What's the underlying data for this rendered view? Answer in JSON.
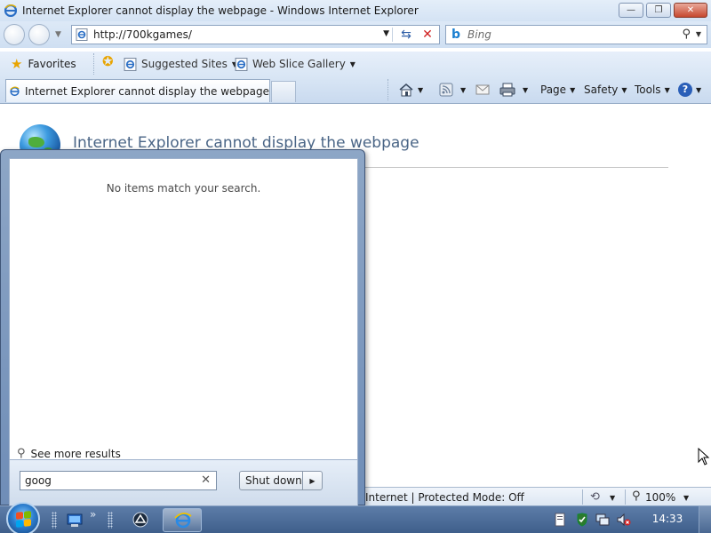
{
  "window": {
    "title": "Internet Explorer cannot display the webpage - Windows Internet Explorer",
    "controls": [
      "minimize",
      "maximize",
      "close"
    ]
  },
  "address_bar": {
    "url": "http://700kgames/"
  },
  "search_box": {
    "placeholder": "Bing"
  },
  "favorites_bar": {
    "favorites_label": "Favorites",
    "links": [
      {
        "label": "Suggested Sites"
      },
      {
        "label": "Web Slice Gallery"
      }
    ]
  },
  "tab": {
    "label": "Internet Explorer cannot display the webpage"
  },
  "command_bar": {
    "page_label": "Page",
    "safety_label": "Safety",
    "tools_label": "Tools"
  },
  "page": {
    "error_title": "Internet Explorer cannot display the webpage"
  },
  "status_bar": {
    "zone_text": "Internet | Protected Mode: Off",
    "zoom": "100%"
  },
  "start_menu": {
    "empty_message": "No items match your search.",
    "see_more_label": "See more results",
    "search_text": "goog",
    "shutdown_label": "Shut down"
  },
  "taskbar": {
    "clock": "14:33"
  },
  "colors": {
    "accent_title": "#4a6586",
    "taskbar": "#3f5f8b",
    "start_menu_frame": "#7d98bd"
  },
  "icons": [
    "ie-icon",
    "bing-icon",
    "favorites-star-icon",
    "globe-icon",
    "start-orb-icon",
    "see-more-search-icon"
  ]
}
